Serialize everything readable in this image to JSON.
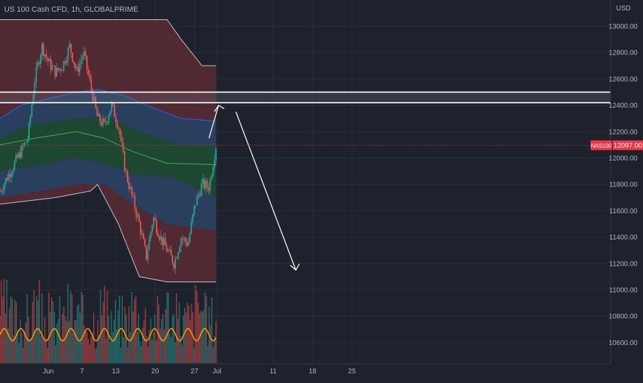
{
  "header": {
    "title": "US 100 Cash CFD, 1h, GLOBALPRIME"
  },
  "price_axis": {
    "currency": "USD"
  },
  "last_price": {
    "symbol": "NAS100",
    "value": "12097.00"
  },
  "colors": {
    "background": "#1e222d",
    "grid": "#2a2e39",
    "up_candle": "#26a69a",
    "down_candle": "#ef5350",
    "outer_band": "#5b2a35",
    "mid_band": "#2c4466",
    "inner_band": "#1f4d32",
    "volume_ma": "#ff9800",
    "drawing": "#ffffff",
    "price_label": "#f23645"
  },
  "chart_data": {
    "type": "candlestick",
    "title": "US 100 Cash CFD, 1h, GLOBALPRIME",
    "y_ticks": [
      "13000.00",
      "12800.00",
      "12600.00",
      "12400.00",
      "12200.00",
      "12000.00",
      "11800.00",
      "11600.00",
      "11400.00",
      "11200.00",
      "11000.00",
      "10800.00",
      "10600.00"
    ],
    "x_ticks": [
      "Jun",
      "7",
      "13",
      "20",
      "27",
      "Jul",
      "11",
      "18",
      "25"
    ],
    "ylim": [
      10500,
      13150
    ],
    "grid": true,
    "last_price": 12097,
    "symbol": "NAS100",
    "price_path": [
      [
        0,
        11750
      ],
      [
        2,
        11950
      ],
      [
        4,
        12150
      ],
      [
        5,
        12600
      ],
      [
        6,
        12850
      ],
      [
        7,
        12720
      ],
      [
        8,
        12650
      ],
      [
        9,
        12700
      ],
      [
        10,
        12850
      ],
      [
        11,
        12650
      ],
      [
        12,
        12800
      ],
      [
        13,
        12550
      ],
      [
        14,
        12300
      ],
      [
        15,
        12250
      ],
      [
        16,
        12400
      ],
      [
        17,
        12250
      ],
      [
        18,
        11900
      ],
      [
        19,
        11700
      ],
      [
        20,
        11500
      ],
      [
        21,
        11250
      ],
      [
        22,
        11550
      ],
      [
        23,
        11400
      ],
      [
        24,
        11300
      ],
      [
        25,
        11200
      ],
      [
        26,
        11400
      ],
      [
        27,
        11350
      ],
      [
        28,
        11650
      ],
      [
        29,
        11800
      ],
      [
        30,
        11780
      ],
      [
        31,
        12097
      ]
    ],
    "zone": {
      "high": 12500,
      "low": 12420
    },
    "arrow_path": [
      [
        30,
        12150
      ],
      [
        31.2,
        12400
      ],
      [
        32.5,
        12350
      ],
      [
        37,
        11150
      ]
    ],
    "bands": {
      "outer_top": [
        [
          0,
          13050
        ],
        [
          10,
          13050
        ],
        [
          24,
          13050
        ],
        [
          26,
          12900
        ],
        [
          29,
          12700
        ],
        [
          31,
          12700
        ]
      ],
      "blue_top": [
        [
          0,
          12300
        ],
        [
          3,
          12400
        ],
        [
          11,
          12500
        ],
        [
          14,
          12520
        ],
        [
          18,
          12470
        ],
        [
          22,
          12380
        ],
        [
          26,
          12300
        ],
        [
          31,
          12280
        ]
      ],
      "green_top": [
        [
          0,
          12150
        ],
        [
          4,
          12250
        ],
        [
          11,
          12300
        ],
        [
          15,
          12310
        ],
        [
          18,
          12250
        ],
        [
          23,
          12140
        ],
        [
          27,
          12100
        ],
        [
          31,
          12090
        ]
      ],
      "green_bottom": [
        [
          0,
          11900
        ],
        [
          6,
          11950
        ],
        [
          11,
          12000
        ],
        [
          15,
          11960
        ],
        [
          19,
          11880
        ],
        [
          25,
          11850
        ],
        [
          31,
          11700
        ]
      ],
      "blue_bottom": [
        [
          0,
          11700
        ],
        [
          6,
          11750
        ],
        [
          11,
          11800
        ],
        [
          15,
          11800
        ],
        [
          19,
          11650
        ],
        [
          24,
          11500
        ],
        [
          31,
          11450
        ]
      ],
      "outer_bottom": [
        [
          0,
          11650
        ],
        [
          8,
          11700
        ],
        [
          13,
          11750
        ],
        [
          14,
          11800
        ],
        [
          17,
          11500
        ],
        [
          20,
          11100
        ],
        [
          24,
          11060
        ],
        [
          31,
          11060
        ]
      ],
      "mid_line": [
        [
          0,
          12100
        ],
        [
          5,
          12150
        ],
        [
          11,
          12200
        ],
        [
          15,
          12150
        ],
        [
          19,
          12050
        ],
        [
          24,
          11960
        ],
        [
          31,
          11950
        ]
      ]
    },
    "volume": {
      "bar_count": 160,
      "moving_average": true
    }
  }
}
